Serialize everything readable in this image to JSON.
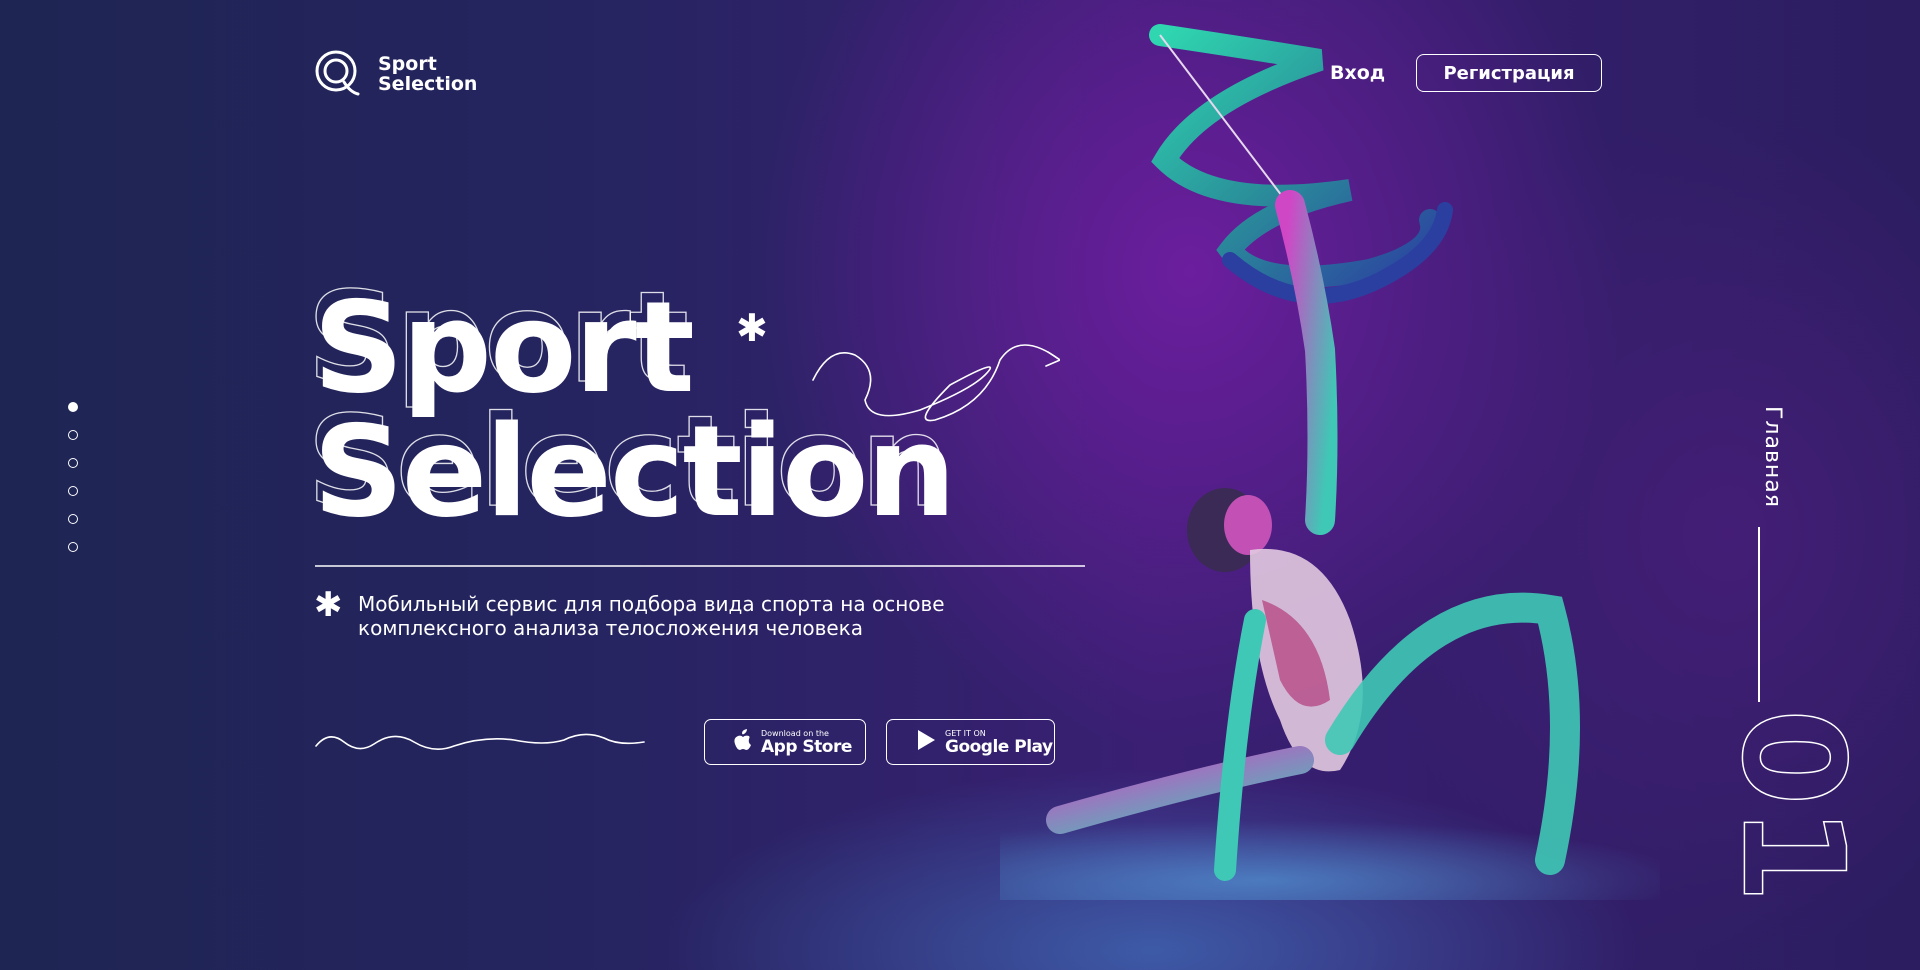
{
  "header": {
    "logo_line1": "Sport",
    "logo_line2": "Selection",
    "login_label": "Вход",
    "register_label": "Регистрация"
  },
  "hero": {
    "title_line1": "Sport",
    "title_line2": "Selection",
    "description_line1": "Мобильный сервис для подбора вида спорта на основе",
    "description_line2": "комплексного анализа телосложения человека"
  },
  "stores": {
    "app_store_small": "Download on the",
    "app_store_big": "App Store",
    "google_play_small": "GET IT ON",
    "google_play_big": "Google Play"
  },
  "side": {
    "section_label": "Главная",
    "page_number": "01"
  },
  "nav_dots": {
    "count": 6,
    "active_index": 0
  },
  "colors": {
    "bg_left": "#1e2552",
    "bg_center": "#3a1f73",
    "accent_teal": "#2fd6b0",
    "accent_magenta": "#d43fc8"
  }
}
